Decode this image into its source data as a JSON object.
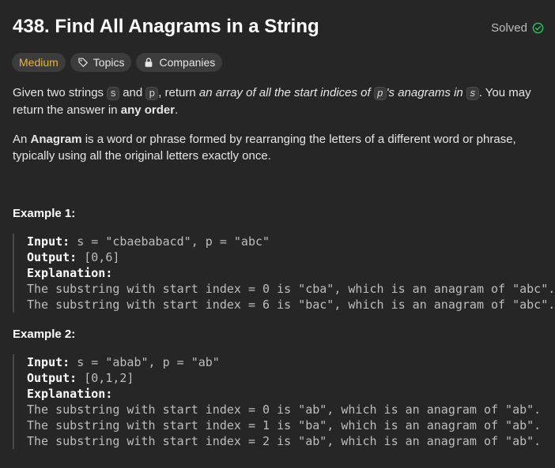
{
  "problem": {
    "title": "438. Find All Anagrams in a String",
    "status": "Solved",
    "difficulty": "Medium",
    "tags": [
      "Topics",
      "Companies"
    ]
  },
  "description": {
    "p1_a": "Given two strings ",
    "code_s": "s",
    "p1_b": " and ",
    "code_p": "p",
    "p1_c": ", return ",
    "p1_em": "an array of all the start indices of ",
    "p1_em_code_p": "p",
    "p1_em2": "'s anagrams in ",
    "p1_em_code_s": "s",
    "p1_d": ". You may return the answer in ",
    "p1_strong": "any order",
    "p1_e": ".",
    "p2_a": "An ",
    "p2_strong": "Anagram",
    "p2_b": " is a word or phrase formed by rearranging the letters of a different word or phrase, typically using all the original letters exactly once."
  },
  "examples": [
    {
      "heading": "Example 1:",
      "input_label": "Input:",
      "input": " s = \"cbaebabacd\", p = \"abc\"",
      "output_label": "Output:",
      "output": " [0,6]",
      "explanation_label": "Explanation:",
      "explanation": [
        "The substring with start index = 0 is \"cba\", which is an anagram of \"abc\".",
        "The substring with start index = 6 is \"bac\", which is an anagram of \"abc\"."
      ]
    },
    {
      "heading": "Example 2:",
      "input_label": "Input:",
      "input": " s = \"abab\", p = \"ab\"",
      "output_label": "Output:",
      "output": " [0,1,2]",
      "explanation_label": "Explanation:",
      "explanation": [
        "The substring with start index = 0 is \"ab\", which is an anagram of \"ab\".",
        "The substring with start index = 1 is \"ba\", which is an anagram of \"ab\".",
        "The substring with start index = 2 is \"ab\", which is an anagram of \"ab\"."
      ]
    }
  ],
  "colors": {
    "background": "#262626",
    "difficulty_medium": "#f0b232",
    "solved_check": "#2cbb5d"
  },
  "icons": [
    "check-circle-icon",
    "tag-icon",
    "lock-icon"
  ]
}
